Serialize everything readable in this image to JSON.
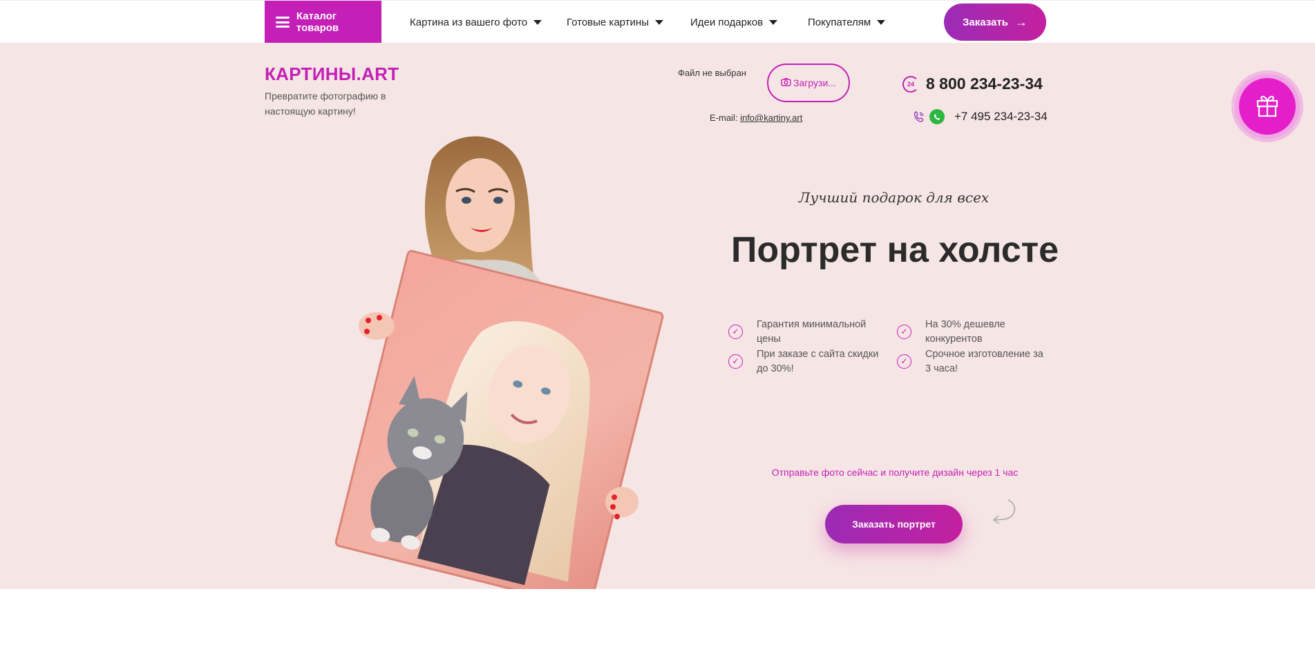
{
  "topbar": {
    "catalog_label": "Каталог товаров",
    "nav": [
      {
        "label": "Картина из вашего фото"
      },
      {
        "label": "Готовые картины"
      },
      {
        "label": "Идеи подарков"
      },
      {
        "label": "Покупателям"
      }
    ],
    "order_label": "Заказать"
  },
  "header": {
    "logo": "КАРТИНЫ.ART",
    "tagline": "Превратите фотографию в настоящую картину!",
    "file_status": "Файл не выбран",
    "upload_label": "Загрузи...",
    "email_label": "E-mail:",
    "email_value": "info@kartiny.art",
    "phone_main": "8 800 234-23-34",
    "phone_badge": "24",
    "phone_secondary": "+7 495 234-23-34"
  },
  "hero": {
    "subtitle": "Лучший подарок для всех",
    "title": "Портрет на холсте",
    "benefits": [
      {
        "text": "Гарантия минимальной цены"
      },
      {
        "text": "На 30% дешевле конкурентов"
      },
      {
        "text": "При заказе с сайта скидки до 30%!"
      },
      {
        "text": "Срочное изготовление за 3 часа!"
      }
    ],
    "cta_note": "Отправьте фото сейчас и получите дизайн через 1 час",
    "cta_label": "Заказать портрет"
  },
  "colors": {
    "accent": "#c41fb6",
    "hero_bg": "#f6e5e5",
    "gift": "#e41fc9",
    "whatsapp": "#2bb741"
  },
  "icons": [
    "menu-icon",
    "chevron-down-icon",
    "arrow-right-icon",
    "camera-icon",
    "clock-24-icon",
    "viber-icon",
    "whatsapp-icon",
    "gift-icon",
    "check-icon",
    "curved-arrow-icon"
  ]
}
